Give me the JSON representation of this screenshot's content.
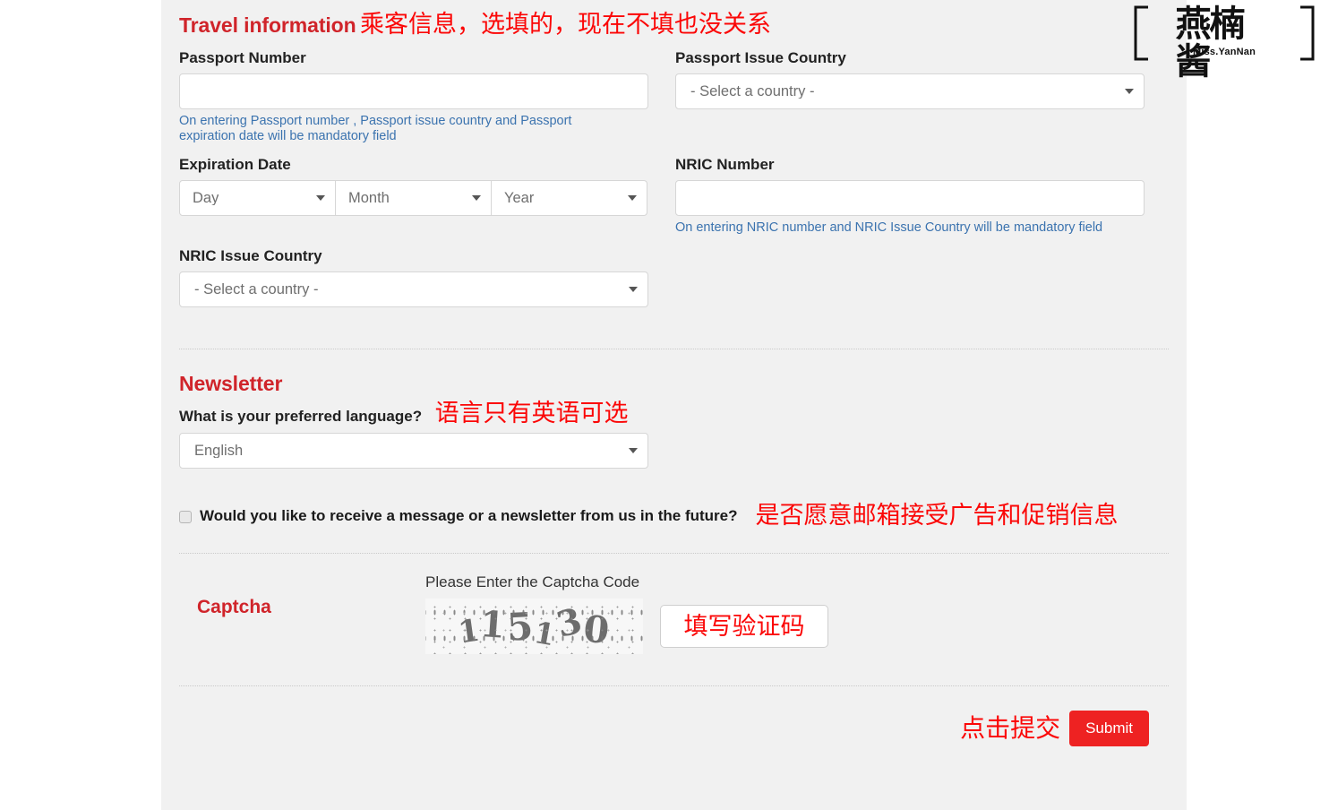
{
  "travel": {
    "title": "Travel information",
    "annotation": "乘客信息，选填的，现在不填也没关系",
    "passport_number_label": "Passport Number",
    "passport_number_value": "",
    "passport_helper": "On entering Passport number , Passport issue country and Passport expiration date will be mandatory field",
    "passport_issue_country_label": "Passport Issue Country",
    "passport_issue_country_value": "- Select a country -",
    "expiration_date_label": "Expiration Date",
    "expiration_day": "Day",
    "expiration_month": "Month",
    "expiration_year": "Year",
    "nric_number_label": "NRIC Number",
    "nric_number_value": "",
    "nric_helper": "On entering NRIC number and NRIC Issue Country will be mandatory field",
    "nric_issue_country_label": "NRIC Issue Country",
    "nric_issue_country_value": "- Select a country -"
  },
  "newsletter": {
    "title": "Newsletter",
    "language_question": "What is your preferred language?",
    "language_annotation": "语言只有英语可选",
    "language_value": "English",
    "consent_label": "Would you like to receive a message or a newsletter from us in the future?",
    "consent_annotation": "是否愿意邮箱接受广告和促销信息",
    "consent_checked": false
  },
  "captcha": {
    "title": "Captcha",
    "prompt": "Please Enter the Captcha Code",
    "code": "115130",
    "input_value": "",
    "input_annotation": "填写验证码"
  },
  "footer": {
    "submit_annotation": "点击提交",
    "submit_label": "Submit"
  },
  "watermark": {
    "cn": "燕楠酱",
    "sub": "Miss.YanNan"
  },
  "colors": {
    "section_heading": "#d0242a",
    "annotation_red": "#fb0707",
    "helper_blue": "#3b73af",
    "submit_red": "#ee2222",
    "panel_bg": "#f1f1f1"
  }
}
